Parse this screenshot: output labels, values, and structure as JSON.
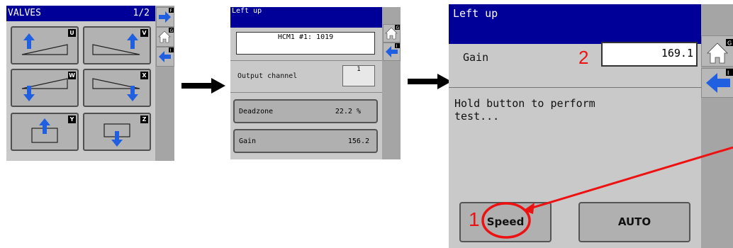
{
  "screen1": {
    "title": "VALVES",
    "page": "1/2",
    "valve_buttons": [
      {
        "badge": "U"
      },
      {
        "badge": "V"
      },
      {
        "badge": "W"
      },
      {
        "badge": "X"
      },
      {
        "badge": "Y"
      },
      {
        "badge": "Z"
      }
    ],
    "side_badges": [
      "F",
      "G",
      "I"
    ]
  },
  "screen2": {
    "title": "Left up",
    "device_value": "HCM1 #1: 1019",
    "output_channel_label": "Output channel",
    "output_channel_value": "1",
    "deadzone_label": "Deadzone",
    "deadzone_value": "22.2 %",
    "gain_label": "Gain",
    "gain_value": "156.2",
    "side_badges": [
      "G",
      "I"
    ]
  },
  "screen3": {
    "title": "Left up",
    "gain_label": "Gain",
    "gain_value": "169.1",
    "message": "Hold button to perform\ntest...",
    "speed_label": "Speed",
    "auto_label": "AUTO",
    "side_badges": [
      "G",
      "I"
    ]
  },
  "annotations": {
    "marker_1": "1",
    "marker_2": "2"
  },
  "colors": {
    "header": "#000099",
    "panel": "#c9c9c9",
    "arrow": "#1f5fe0",
    "annotation": "#ee1111"
  }
}
